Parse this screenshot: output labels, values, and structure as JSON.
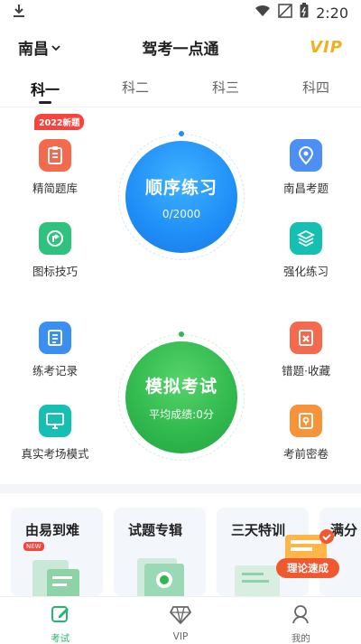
{
  "status_bar": {
    "time": "2:20"
  },
  "header": {
    "city": "南昌",
    "title": "驾考一点通",
    "vip": "VIP"
  },
  "tabs": [
    {
      "label": "科一",
      "active": true
    },
    {
      "label": "科二",
      "active": false
    },
    {
      "label": "科三",
      "active": false
    },
    {
      "label": "科四",
      "active": false
    }
  ],
  "features_left": [
    {
      "label": "精简题库",
      "color": "#f46a4e",
      "icon": "document-icon"
    },
    {
      "label": "图标技巧",
      "color": "#2ec27e",
      "icon": "sign-icon"
    },
    {
      "label": "练考记录",
      "color": "#3b8ff0",
      "icon": "record-icon"
    },
    {
      "label": "真实考场模式",
      "color": "#15c0b3",
      "icon": "monitor-icon"
    }
  ],
  "features_right": [
    {
      "label": "南昌考题",
      "color": "#4d8ff3",
      "icon": "location-icon"
    },
    {
      "label": "强化练习",
      "color": "#15c0b3",
      "icon": "layers-icon"
    },
    {
      "label": "错题·收藏",
      "color": "#f46a4e",
      "icon": "error-icon"
    },
    {
      "label": "考前密卷",
      "color": "#f7943a",
      "icon": "secret-paper-icon"
    }
  ],
  "badge_2022": "2022新题",
  "practice_circle": {
    "title": "顺序练习",
    "progress": "0/2000",
    "color": "#1f8ef7"
  },
  "exam_circle": {
    "title": "模拟考试",
    "subtitle": "平均成绩:0分",
    "color": "#2fb84d"
  },
  "promos": [
    {
      "title": "由易到难",
      "badge": "NEW"
    },
    {
      "title": "试题专辑"
    },
    {
      "title": "三天特训"
    },
    {
      "title": "满分"
    }
  ],
  "fast_badge": "理论速成",
  "bottom_nav": [
    {
      "label": "考试",
      "icon": "edit-icon",
      "active": true
    },
    {
      "label": "VIP",
      "icon": "diamond-icon",
      "active": false
    },
    {
      "label": "我的",
      "icon": "user-icon",
      "active": false
    }
  ]
}
